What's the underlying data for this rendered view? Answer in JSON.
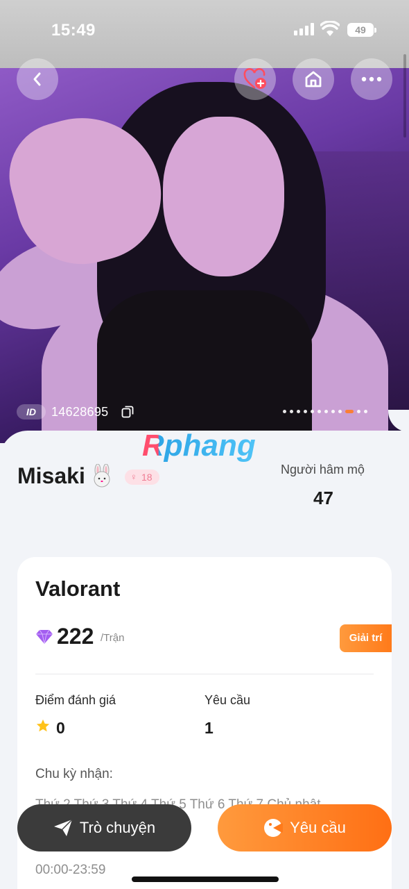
{
  "status_bar": {
    "time": "15:49",
    "battery": "49"
  },
  "profile": {
    "id_label": "ID",
    "id_number": "14628695",
    "name": "Misaki",
    "age": "18",
    "fans_label": "Người hâm mộ",
    "fans_count": "47"
  },
  "photo": {
    "page_count": 12,
    "active_page": 10
  },
  "watermark": "Rphang",
  "service": {
    "game": "Valorant",
    "price": "222",
    "price_unit": "/Trận",
    "tag": "Giải trí",
    "rating_label": "Điểm đánh giá",
    "rating_value": "0",
    "request_label": "Yêu cầu",
    "request_value": "1",
    "cycle_label": "Chu kỳ nhận:",
    "days": "Thứ 2 Thứ 3 Thứ 4 Thứ 5 Thứ 6 Thứ 7 Chủ nhật",
    "hours": "00:00-23:59"
  },
  "actions": {
    "chat": "Trò chuyện",
    "request": "Yêu cầu"
  },
  "colors": {
    "accent": "#ff7a1a",
    "dark_button": "#3b3b3b",
    "badge_pink": "#ef7c93"
  }
}
